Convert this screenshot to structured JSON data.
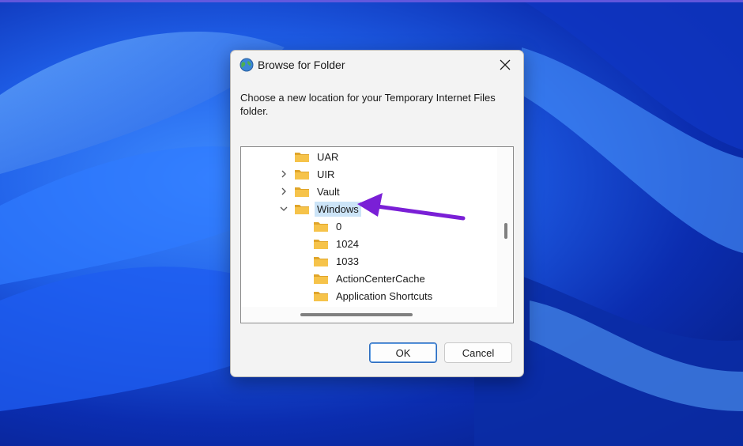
{
  "dialog": {
    "title": "Browse for Folder",
    "description": "Choose a new location for your Temporary Internet Files folder.",
    "ok_label": "OK",
    "cancel_label": "Cancel"
  },
  "tree": {
    "items": [
      {
        "label": "UAR",
        "expander": "none",
        "indent": 1
      },
      {
        "label": "UIR",
        "expander": "collapsed",
        "indent": 1
      },
      {
        "label": "Vault",
        "expander": "collapsed",
        "indent": 1
      },
      {
        "label": "Windows",
        "expander": "expanded",
        "indent": 1,
        "selected": true
      },
      {
        "label": "0",
        "expander": "none",
        "indent": 2
      },
      {
        "label": "1024",
        "expander": "none",
        "indent": 2
      },
      {
        "label": "1033",
        "expander": "none",
        "indent": 2
      },
      {
        "label": "ActionCenterCache",
        "expander": "none",
        "indent": 2
      },
      {
        "label": "Application Shortcuts",
        "expander": "none",
        "indent": 2
      }
    ]
  },
  "colors": {
    "annotation_arrow": "#7a1fd6",
    "selection": "#cce4f7",
    "folder": "#f6c34a"
  },
  "icons": {
    "title": "globe-icon",
    "close": "close-icon",
    "folder": "folder-icon",
    "expand": "chevron-right-icon",
    "collapse": "chevron-down-icon"
  }
}
